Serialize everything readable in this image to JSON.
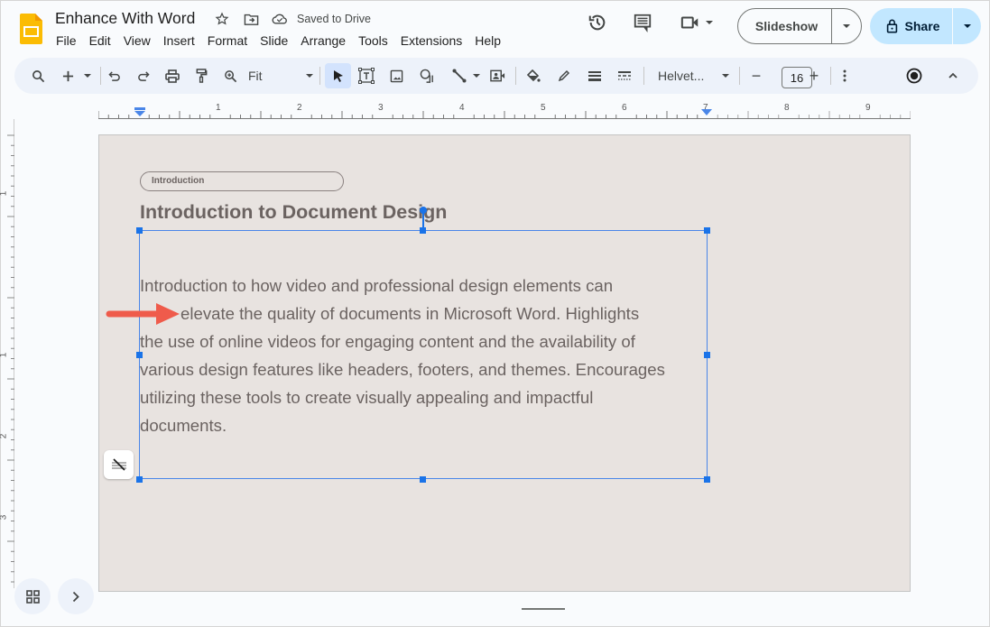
{
  "app": {
    "title": "Enhance With Word",
    "saved_status": "Saved to Drive",
    "brand_color": "#fbbc04"
  },
  "menu": [
    "File",
    "Edit",
    "View",
    "Insert",
    "Format",
    "Slide",
    "Arrange",
    "Tools",
    "Extensions",
    "Help"
  ],
  "header_actions": {
    "history_icon": "history-icon",
    "comments_icon": "comment-icon",
    "meet_icon": "video-camera-icon",
    "slideshow_label": "Slideshow",
    "share_label": "Share",
    "share_color": "#c2e7ff"
  },
  "toolbar": {
    "zoom_value": "Fit",
    "font_name": "Helvet...",
    "font_size": "16",
    "decrease_label": "−",
    "increase_label": "+"
  },
  "ruler": {
    "horizontal_labels": [
      "1",
      "2",
      "3",
      "4",
      "5",
      "6",
      "7",
      "8",
      "9"
    ],
    "vertical_labels": [
      "1",
      "1",
      "2",
      "3"
    ]
  },
  "slide": {
    "tag_label": "Introduction",
    "heading": "Introduction to Document Design",
    "body_lines": [
      "Introduction to how video and professional design elements can",
      "elevate the quality of documents in Microsoft Word. Highlights",
      "the use of online videos for engaging content and the availability of",
      "various design features like headers, footers, and themes. Encourages",
      "utilizing these tools to create visually appealing and impactful",
      "documents."
    ],
    "background_color": "#e8e3e0",
    "text_color": "#6b6361",
    "selection_color": "#1a73e8",
    "annotation_arrow_color": "#ef5b4b"
  }
}
